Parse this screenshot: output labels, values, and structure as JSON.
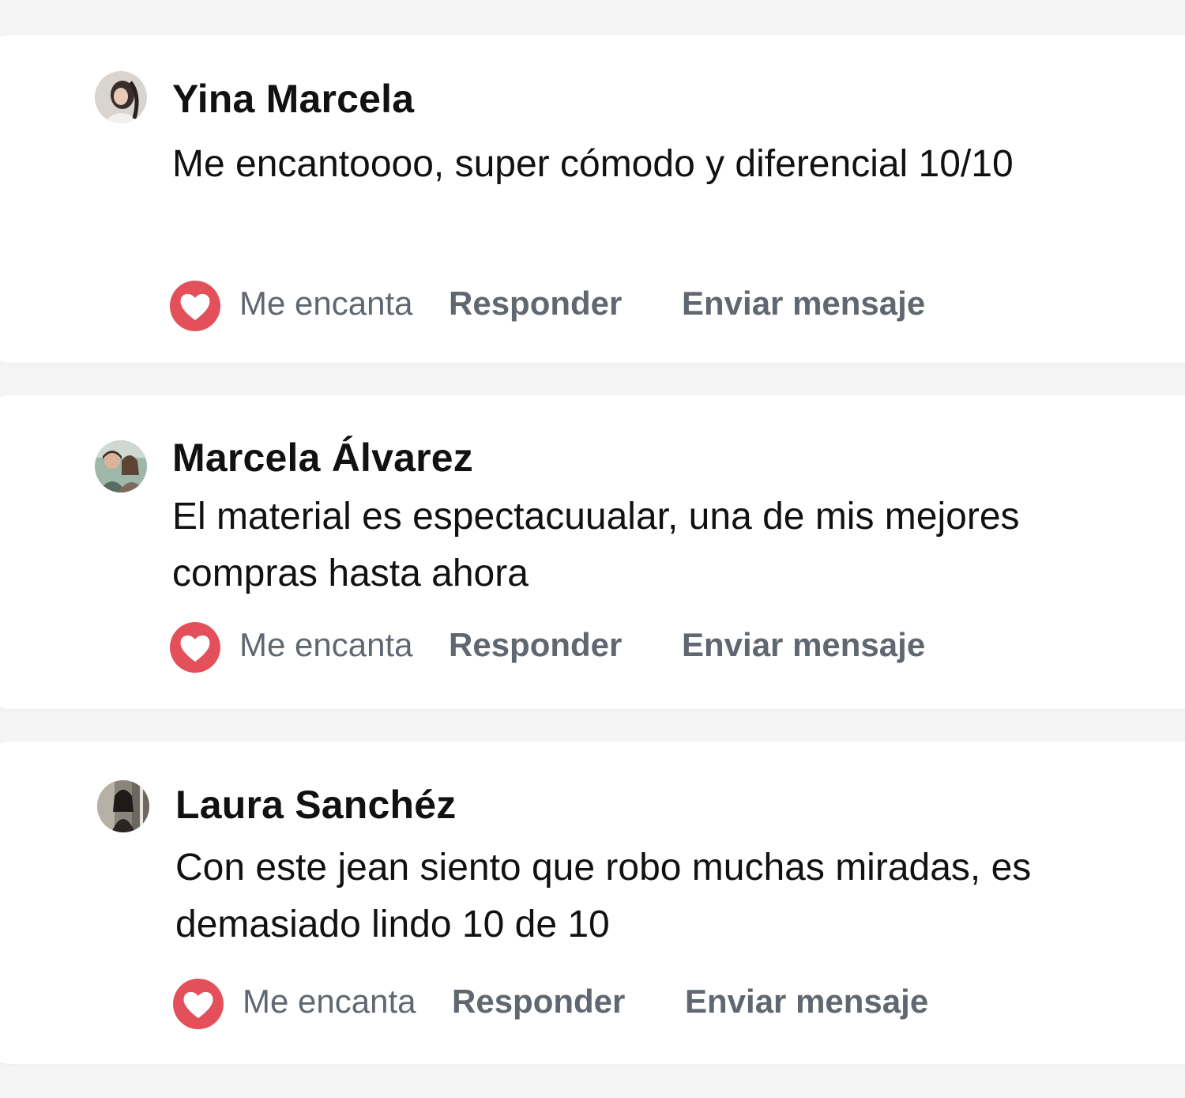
{
  "comments": [
    {
      "author": "Yina Marcela",
      "text": "Me encantoooo, super cómodo y diferencial 10/10",
      "reaction_label": "Me encanta",
      "reply_label": "Responder",
      "message_label": "Enviar mensaje"
    },
    {
      "author": "Marcela Álvarez",
      "text": "El material es espectacuualar, una de mis mejores compras hasta ahora",
      "reaction_label": "Me encanta",
      "reply_label": "Responder",
      "message_label": "Enviar mensaje"
    },
    {
      "author": "Laura Sanchéz",
      "text": "Con este jean siento que robo muchas miradas, es demasiado lindo 10 de 10",
      "reaction_label": "Me encanta",
      "reply_label": "Responder",
      "message_label": "Enviar mensaje"
    }
  ],
  "icons": {
    "reaction": "heart-icon",
    "avatar": "user-photo"
  },
  "colors": {
    "heart": "#e4505a",
    "action_text": "#606770",
    "card_bg": "#ffffff",
    "page_bg": "#f5f5f5"
  }
}
